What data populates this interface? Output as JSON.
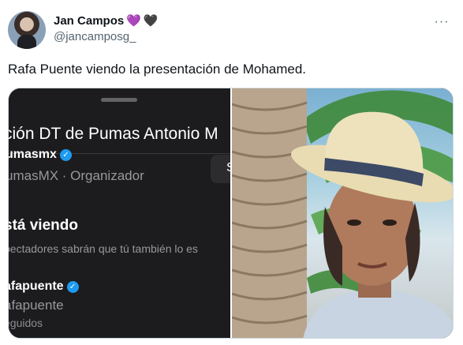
{
  "tweet": {
    "display_name": "Jan Campos",
    "emoji_hearts": [
      "💜",
      "🖤"
    ],
    "handle": "@jancamposg_",
    "more_label": "···",
    "text": "Rafa Puente viendo la presentación de Mohamed."
  },
  "screenshot": {
    "space_title": "ción DT de Pumas Antonio M",
    "side_button": "S",
    "host_handle": "umasmx",
    "host_sub": "umasMX · Organizador",
    "section_title": "stá viendo",
    "section_desc": "pectadores sabrán que tú también lo es",
    "listener_handle": "afapuente",
    "listener_sub": "afapuente",
    "listener_follow": "eguidos"
  }
}
